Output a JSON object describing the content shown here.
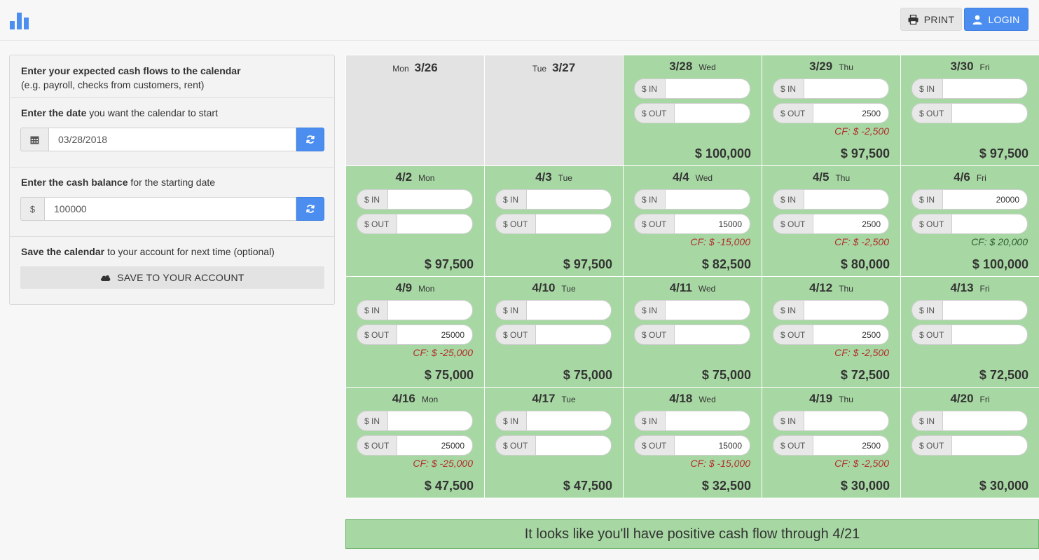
{
  "header": {
    "logo_icon": "bar-chart-icon",
    "print_label": "PRINT",
    "print_icon": "printer-icon",
    "login_label": "LOGIN",
    "login_icon": "user-icon"
  },
  "panel": {
    "intro_title": "Enter your expected cash flows to the calendar",
    "intro_subtitle": "(e.g. payroll, checks from customers, rent)",
    "date_label_bold": "Enter the date",
    "date_label_rest": " you want the calendar to start",
    "date_value": "03/28/2018",
    "balance_label_bold": "Enter the cash balance",
    "balance_label_rest": " for the starting date",
    "currency_symbol": "$",
    "balance_value": "100000",
    "save_label_bold": "Save the calendar",
    "save_label_rest": " to your account for next time (optional)",
    "save_button": "SAVE TO YOUR ACCOUNT",
    "save_icon": "cloud-icon"
  },
  "calendar": {
    "in_label": "$ IN",
    "out_label": "$ OUT",
    "days": [
      {
        "dow": "Mon",
        "date": "3/26",
        "past": true
      },
      {
        "dow": "Tue",
        "date": "3/27",
        "past": true
      },
      {
        "dow": "Wed",
        "date": "3/28",
        "in": "",
        "out": "",
        "cf": "",
        "balance": "$ 100,000"
      },
      {
        "dow": "Thu",
        "date": "3/29",
        "in": "",
        "out": "2500",
        "cf": "CF: $ -2,500",
        "balance": "$ 97,500"
      },
      {
        "dow": "Fri",
        "date": "3/30",
        "in": "",
        "out": "",
        "cf": "",
        "balance": "$ 97,500"
      },
      {
        "dow": "Mon",
        "date": "4/2",
        "in": "",
        "out": "",
        "cf": "",
        "balance": "$ 97,500"
      },
      {
        "dow": "Tue",
        "date": "4/3",
        "in": "",
        "out": "",
        "cf": "",
        "balance": "$ 97,500"
      },
      {
        "dow": "Wed",
        "date": "4/4",
        "in": "",
        "out": "15000",
        "cf": "CF: $ -15,000",
        "balance": "$ 82,500"
      },
      {
        "dow": "Thu",
        "date": "4/5",
        "in": "",
        "out": "2500",
        "cf": "CF: $ -2,500",
        "balance": "$ 80,000"
      },
      {
        "dow": "Fri",
        "date": "4/6",
        "in": "20000",
        "out": "",
        "cf": "CF: $ 20,000",
        "balance": "$ 100,000"
      },
      {
        "dow": "Mon",
        "date": "4/9",
        "in": "",
        "out": "25000",
        "cf": "CF: $ -25,000",
        "balance": "$ 75,000"
      },
      {
        "dow": "Tue",
        "date": "4/10",
        "in": "",
        "out": "",
        "cf": "",
        "balance": "$ 75,000"
      },
      {
        "dow": "Wed",
        "date": "4/11",
        "in": "",
        "out": "",
        "cf": "",
        "balance": "$ 75,000"
      },
      {
        "dow": "Thu",
        "date": "4/12",
        "in": "",
        "out": "2500",
        "cf": "CF: $ -2,500",
        "balance": "$ 72,500"
      },
      {
        "dow": "Fri",
        "date": "4/13",
        "in": "",
        "out": "",
        "cf": "",
        "balance": "$ 72,500"
      },
      {
        "dow": "Mon",
        "date": "4/16",
        "in": "",
        "out": "25000",
        "cf": "CF: $ -25,000",
        "balance": "$ 47,500"
      },
      {
        "dow": "Tue",
        "date": "4/17",
        "in": "",
        "out": "",
        "cf": "",
        "balance": "$ 47,500"
      },
      {
        "dow": "Wed",
        "date": "4/18",
        "in": "",
        "out": "15000",
        "cf": "CF: $ -15,000",
        "balance": "$ 32,500"
      },
      {
        "dow": "Thu",
        "date": "4/19",
        "in": "",
        "out": "2500",
        "cf": "CF: $ -2,500",
        "balance": "$ 30,000"
      },
      {
        "dow": "Fri",
        "date": "4/20",
        "in": "",
        "out": "",
        "cf": "",
        "balance": "$ 30,000"
      }
    ]
  },
  "message": "It looks like you'll have positive cash flow through 4/21",
  "colors": {
    "accent": "#4c8ef0",
    "cell_green": "#a7d8a3",
    "cell_past": "#e3e3e3",
    "negative_cf": "#b32a2a",
    "positive_cf": "#2e5a2e"
  }
}
